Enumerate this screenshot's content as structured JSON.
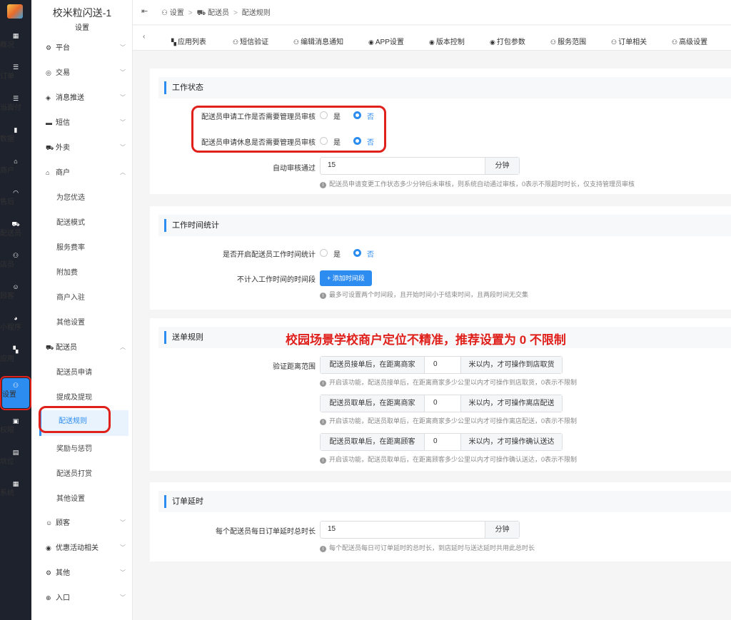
{
  "rail": {
    "items": [
      {
        "icon": "▦",
        "label": "概况"
      },
      {
        "icon": "☰",
        "label": "订单"
      },
      {
        "icon": "☰",
        "label": "当面付"
      },
      {
        "icon": "▮",
        "label": "数据"
      },
      {
        "icon": "⌂",
        "label": "商户"
      },
      {
        "icon": "◠",
        "label": "售后"
      },
      {
        "icon": "⛟",
        "label": "配送员"
      },
      {
        "icon": "⚇",
        "label": "店员"
      },
      {
        "icon": "☺",
        "label": "顾客"
      },
      {
        "icon": "◕",
        "label": "小程序"
      },
      {
        "icon": "▚",
        "label": "应用"
      },
      {
        "icon": "⚇",
        "label": "设置"
      },
      {
        "icon": "▣",
        "label": "权限"
      },
      {
        "icon": "▤",
        "label": "坑位"
      },
      {
        "icon": "▦",
        "label": "系统"
      }
    ]
  },
  "sub": {
    "title": "校米粒闪送-1",
    "subtitle": "设置",
    "groups": {
      "platform": "平台",
      "trade": "交易",
      "push": "消息推送",
      "sms": "短信",
      "takeout": "外卖",
      "merchant": "商户",
      "courier": "配送员",
      "customer": "顾客",
      "promo": "优惠活动相关",
      "other": "其他",
      "entry": "入口"
    },
    "merchant_items": [
      "为您优选",
      "配送模式",
      "服务费率",
      "附加费",
      "商户入驻",
      "其他设置"
    ],
    "courier_items": [
      "配送员申请",
      "提成及提现",
      "配送规则",
      "奖励与惩罚",
      "配送员打赏",
      "其他设置"
    ]
  },
  "breadcrumb": [
    "设置",
    "配送员",
    "配送规则"
  ],
  "tabs": [
    "应用列表",
    "短信验证",
    "编辑消息通知",
    "APP设置",
    "版本控制",
    "打包参数",
    "服务范围",
    "订单相关",
    "高级设置"
  ],
  "work_status": {
    "title": "工作状态",
    "q1": "配送员申请工作是否需要管理员审核",
    "q2": "配送员申请休息是否需要管理员审核",
    "yes": "是",
    "no": "否",
    "auto_label": "自动审核通过",
    "auto_value": "15",
    "auto_unit": "分钟",
    "auto_hint": "配送员申请变更工作状态多少分钟后未审核，则系统自动通过审核，0表示不限超时时长，仅支持管理员审核"
  },
  "work_time": {
    "title": "工作时间统计",
    "q": "是否开启配送员工作时间统计",
    "yes": "是",
    "no": "否",
    "exclude_label": "不计入工作时间的时间段",
    "add_btn": "+ 添加时间段",
    "hint": "最多可设置两个时间段，且开始时间小于结束时间，且两段时间无交集"
  },
  "dispatch": {
    "title": "送单规则",
    "annotation": "校园场景学校商户定位不精准，推荐设置为 0 不限制",
    "label": "验证距离范围",
    "rows": [
      {
        "pre": "配送员接单后，在距离商家",
        "value": "0",
        "post": "米以内，才可操作到店取货",
        "hint": "开启该功能，配送员接单后，在距离商家多少公里以内才可操作到店取货，0表示不限制"
      },
      {
        "pre": "配送员取单后，在距离商家",
        "value": "0",
        "post": "米以内，才可操作离店配送",
        "hint": "开启该功能，配送员取单后，在距离商家多少公里以内才可操作离店配送，0表示不限制"
      },
      {
        "pre": "配送员取单后，在距离顾客",
        "value": "0",
        "post": "米以内，才可操作确认送达",
        "hint": "开启该功能，配送员取单后，在距离顾客多少公里以内才可操作确认送达，0表示不限制"
      }
    ]
  },
  "delay": {
    "title": "订单延时",
    "label": "每个配送员每日订单延时总时长",
    "value": "15",
    "unit": "分钟",
    "hint": "每个配送员每日可订单延时的总时长，到店延时与送达延时共用此总时长"
  },
  "colors": {
    "accent": "#2d8cf0",
    "highlight": "#e0201b",
    "rail": "#1e222d"
  }
}
